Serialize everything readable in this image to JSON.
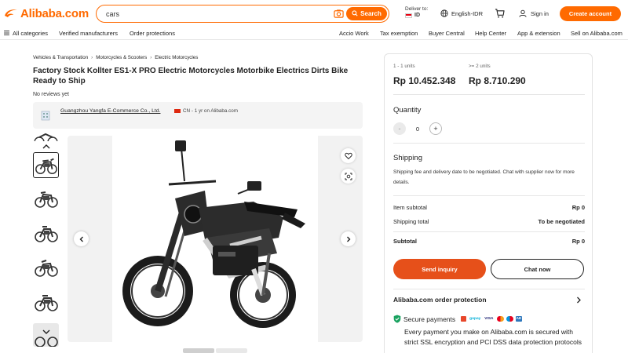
{
  "header": {
    "logo_text": "Alibaba.com",
    "search_value": "cars",
    "search_button": "Search",
    "deliver_label": "Deliver to:",
    "deliver_country": "ID",
    "language": "English-IDR",
    "sign_in": "Sign in",
    "create_account": "Create account"
  },
  "nav": {
    "items": [
      "All categories",
      "Verified manufacturers",
      "Order protections",
      "Accio Work",
      "Tax exemption",
      "Buyer Central",
      "Help Center",
      "App & extension",
      "Sell on Alibaba.com"
    ]
  },
  "breadcrumb": [
    "Vehicles & Transportation",
    "Motorcycles & Scooters",
    "Electric Motorcycles"
  ],
  "product": {
    "title": "Factory Stock Kollter ES1-X PRO Electric Motorcycles Motorbike Electrics Dirts Bike Ready to Ship",
    "reviews": "No reviews yet"
  },
  "supplier": {
    "name": "Guangzhou Yangfa E-Commerce Co., Ltd.",
    "meta": "CN - 1 yr on Alibaba.com"
  },
  "pricing": {
    "tiers": [
      {
        "range": "1 - 1 units",
        "price": "Rp 10.452.348"
      },
      {
        "range": ">= 2 units",
        "price": "Rp 8.710.290"
      }
    ]
  },
  "quantity": {
    "label": "Quantity",
    "value": "0",
    "minus": "-",
    "plus": "+"
  },
  "shipping": {
    "label": "Shipping",
    "text": "Shipping fee and delivery date to be negotiated. Chat with supplier now for more details."
  },
  "summary": {
    "item_subtotal_label": "Item subtotal",
    "item_subtotal_value": "Rp 0",
    "shipping_total_label": "Shipping total",
    "shipping_total_value": "To be negotiated",
    "subtotal_label": "Subtotal",
    "subtotal_value": "Rp 0"
  },
  "actions": {
    "send_inquiry": "Send inquiry",
    "chat_now": "Chat now"
  },
  "protection": {
    "title": "Alibaba.com order protection",
    "secure_label": "Secure payments",
    "payment_logos": [
      "gopay",
      "VISA",
      "mc",
      "mc",
      "AE"
    ],
    "secure_text": "Every payment you make on Alibaba.com is secured with strict SSL encryption and PCI DSS data protection protocols"
  },
  "colors": {
    "brand_orange": "#ff6a00",
    "inquiry_orange": "#e6501a"
  }
}
